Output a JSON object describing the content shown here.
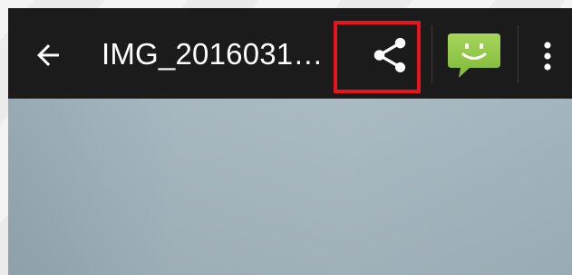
{
  "action_bar": {
    "back_icon": "arrow-left-icon",
    "title": "IMG_2016031…",
    "share_icon": "share-icon",
    "messaging_icon": "messaging-smiley-icon",
    "overflow_icon": "more-vert-icon"
  },
  "colors": {
    "action_bar_bg": "#1b1b1b",
    "highlight": "#e8141c",
    "messaging_green": "#8bc34a",
    "photo_tone": "#a3b5be"
  }
}
